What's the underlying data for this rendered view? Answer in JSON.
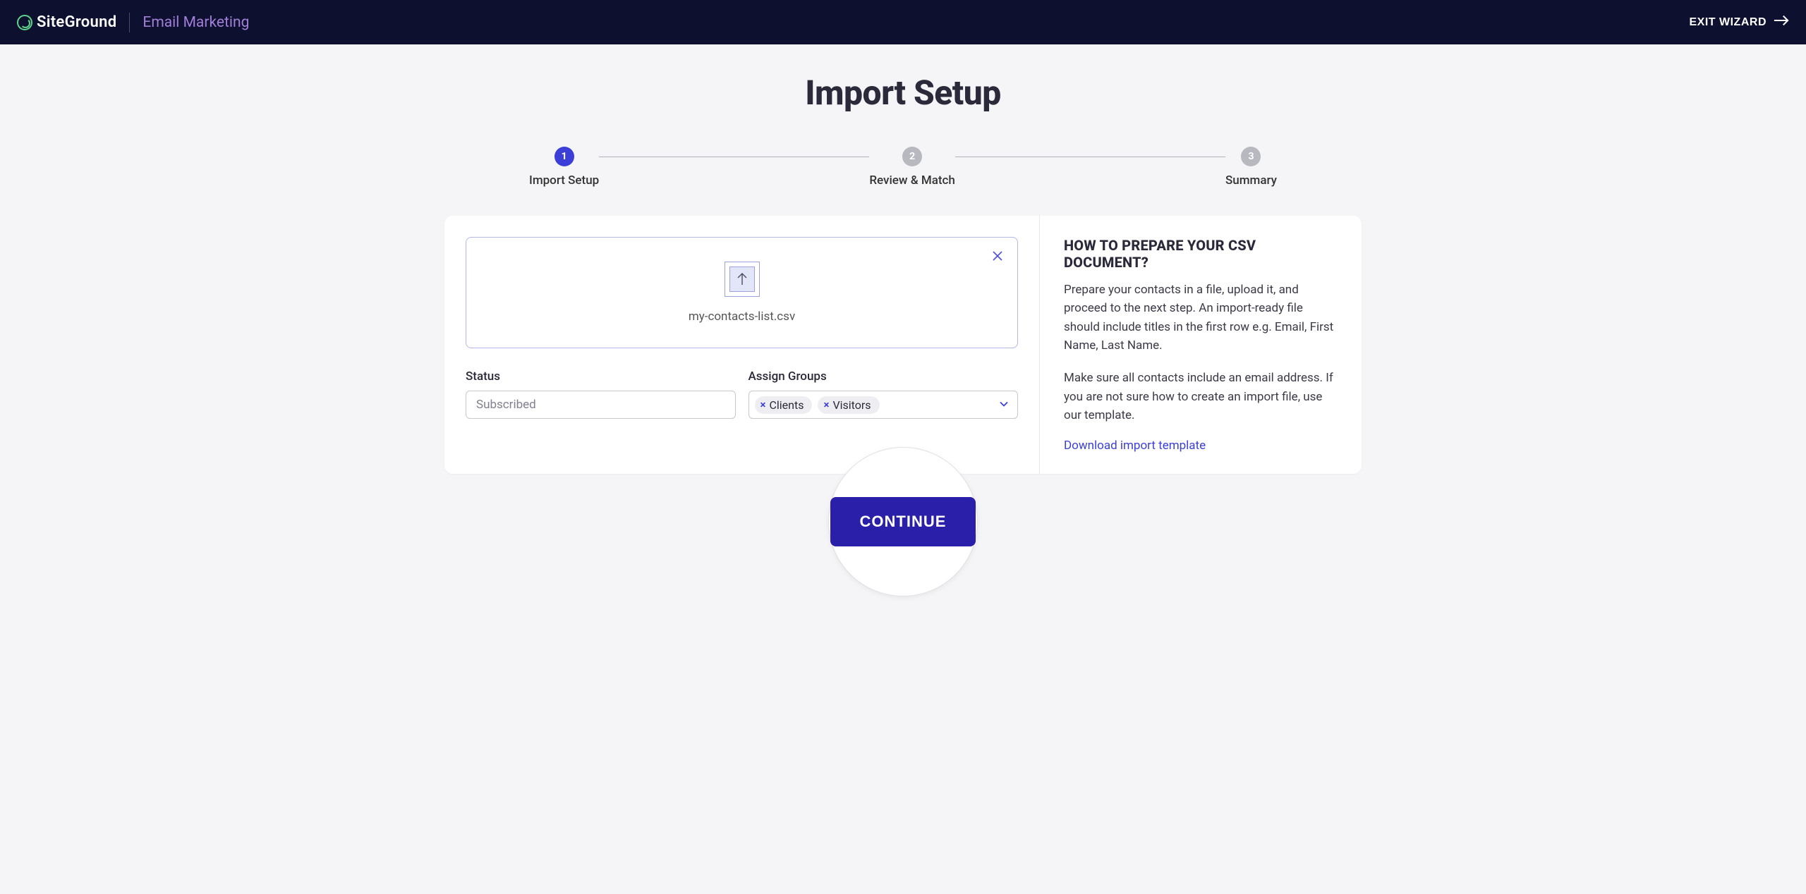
{
  "header": {
    "brand": "SiteGround",
    "product": "Email Marketing",
    "exit_label": "EXIT WIZARD"
  },
  "page": {
    "title": "Import Setup"
  },
  "stepper": {
    "steps": [
      {
        "num": "1",
        "label": "Import Setup",
        "active": true
      },
      {
        "num": "2",
        "label": "Review & Match",
        "active": false
      },
      {
        "num": "3",
        "label": "Summary",
        "active": false
      }
    ]
  },
  "upload": {
    "filename": "my-contacts-list.csv"
  },
  "form": {
    "status_label": "Status",
    "status_value": "Subscribed",
    "groups_label": "Assign Groups",
    "group_tags": [
      "Clients",
      "Visitors"
    ]
  },
  "help": {
    "title": "HOW TO PREPARE YOUR CSV DOCUMENT?",
    "p1": "Prepare your contacts in a file, upload it, and proceed to the next step. An import-ready file should include titles in the first row e.g. Email, First Name, Last Name.",
    "p2": "Make sure all contacts include an email address. If you are not sure how to create an import file, use our template.",
    "link": "Download import template"
  },
  "actions": {
    "continue": "CONTINUE"
  }
}
